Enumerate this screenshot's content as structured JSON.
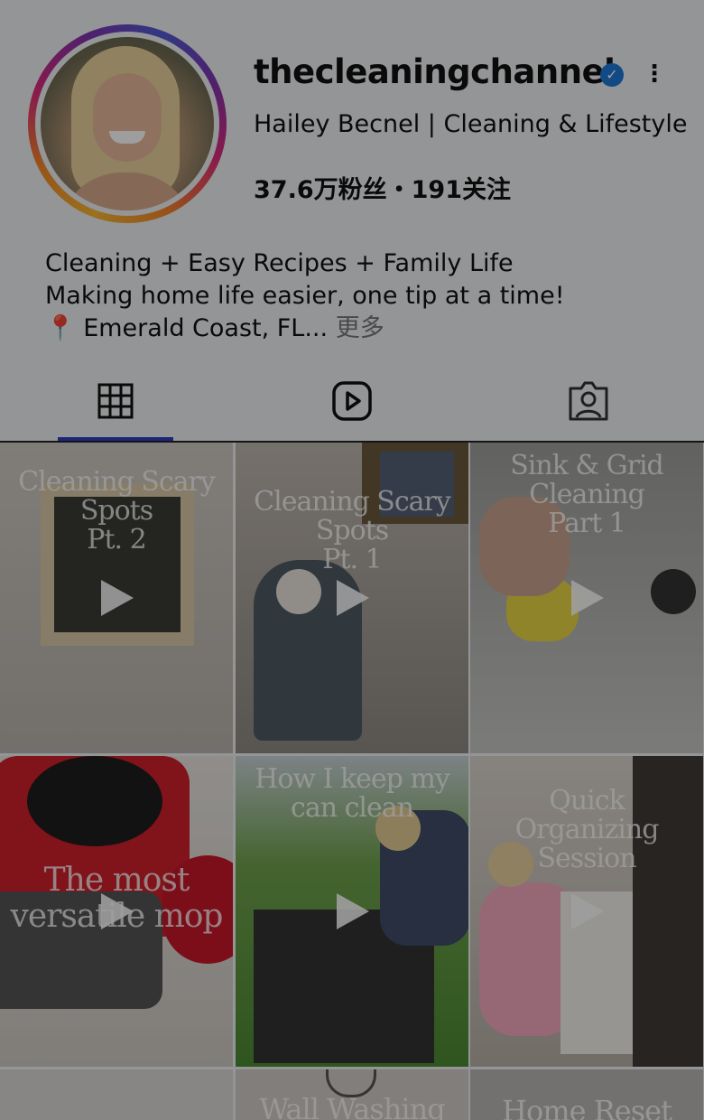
{
  "profile": {
    "username": "thecleaningchannel",
    "full_name": "Hailey Becnel | Cleaning & Lifestyle",
    "stats": "37.6万粉丝・191关注",
    "bio_line1": "Cleaning + Easy Recipes + Family Life",
    "bio_line2": "Making home life easier, one tip at a time!",
    "bio_line3": "📍 Emerald Coast, FL...",
    "more_label": "更多"
  },
  "tabs": [
    {
      "icon": "grid-icon",
      "active": true
    },
    {
      "icon": "reels-icon",
      "active": false
    },
    {
      "icon": "tagged-icon",
      "active": false
    }
  ],
  "posts": [
    {
      "caption": "Cleaning Scary Spots\nPt. 2",
      "type": "reel"
    },
    {
      "caption": "Cleaning Scary Spots\nPt. 1",
      "type": "reel"
    },
    {
      "caption": "Sink & Grid\nCleaning\nPart 1",
      "type": "reel"
    },
    {
      "caption": "The most\nversatile mop",
      "type": "reel"
    },
    {
      "caption": "How I keep my\ncan clean",
      "type": "reel"
    },
    {
      "caption": "Quick\nOrganizing\nSession",
      "type": "reel"
    },
    {
      "caption": "",
      "type": "reel"
    },
    {
      "caption": "Wall Washing",
      "type": "reel"
    },
    {
      "caption": "Home Reset",
      "type": "reel"
    }
  ],
  "colors": {
    "verified": "#1d78d8",
    "tab_underline": "#2e3dc4"
  }
}
